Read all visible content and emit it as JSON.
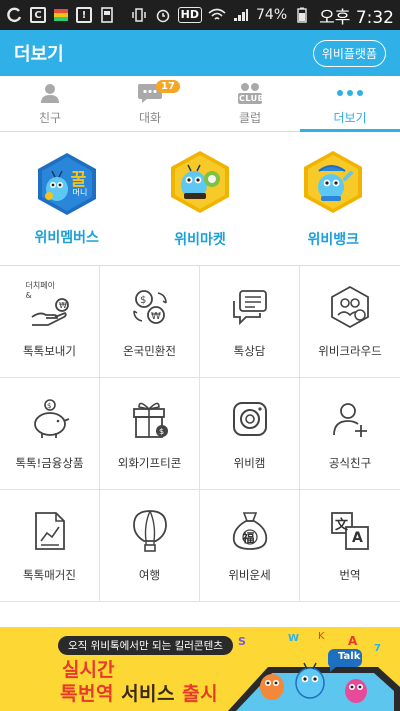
{
  "status_bar": {
    "battery": "74%",
    "time": "오후 7:32",
    "hd_label": "HD"
  },
  "header": {
    "title": "더보기",
    "platform_button": "위비플랫폼"
  },
  "tabs": [
    {
      "label": "친구",
      "icon": "person-icon",
      "active": false
    },
    {
      "label": "대화",
      "icon": "chat-icon",
      "active": false,
      "badge": "17"
    },
    {
      "label": "클럽",
      "icon": "club-icon",
      "active": false,
      "icon_text": "CLUB"
    },
    {
      "label": "더보기",
      "icon": "more-dots-icon",
      "active": true
    }
  ],
  "featured": [
    {
      "label": "위비멤버스",
      "icon": "wibee-members-hex-icon",
      "icon_text": "꿀",
      "icon_sub": "머니"
    },
    {
      "label": "위비마켓",
      "icon": "wibee-market-hex-icon"
    },
    {
      "label": "위비뱅크",
      "icon": "wibee-bank-hex-icon"
    }
  ],
  "grid": [
    {
      "label": "톡톡보내기",
      "icon": "send-money-hand-icon",
      "icon_text": "더치페이\n&"
    },
    {
      "label": "온국민환전",
      "icon": "currency-exchange-icon"
    },
    {
      "label": "톡상담",
      "icon": "chat-consult-icon"
    },
    {
      "label": "위비크라우드",
      "icon": "crowd-funding-icon"
    },
    {
      "label": "톡톡!금융상품",
      "icon": "piggy-bank-icon"
    },
    {
      "label": "외화기프티콘",
      "icon": "gift-box-icon"
    },
    {
      "label": "위비캠",
      "icon": "camera-icon"
    },
    {
      "label": "공식친구",
      "icon": "add-friend-icon"
    },
    {
      "label": "톡톡매거진",
      "icon": "magazine-chart-icon"
    },
    {
      "label": "여행",
      "icon": "hot-air-balloon-icon"
    },
    {
      "label": "위비운세",
      "icon": "fortune-bag-icon",
      "icon_text": "福"
    },
    {
      "label": "번역",
      "icon": "translate-icon",
      "icon_text": "文",
      "icon_text2": "A"
    }
  ],
  "banner": {
    "pill": "오직 위비톡에서만 되는 킬러콘텐츠",
    "line1": "실시간",
    "line2_a": "톡번역",
    "line2_b": "서비스",
    "line2_c": "출시",
    "talk_bubble": "Talk"
  },
  "colors": {
    "primary": "#2fb0e6",
    "honey": "#f5c31a",
    "banner_bg": "#fdd835",
    "banner_text": "#e63a2a"
  }
}
